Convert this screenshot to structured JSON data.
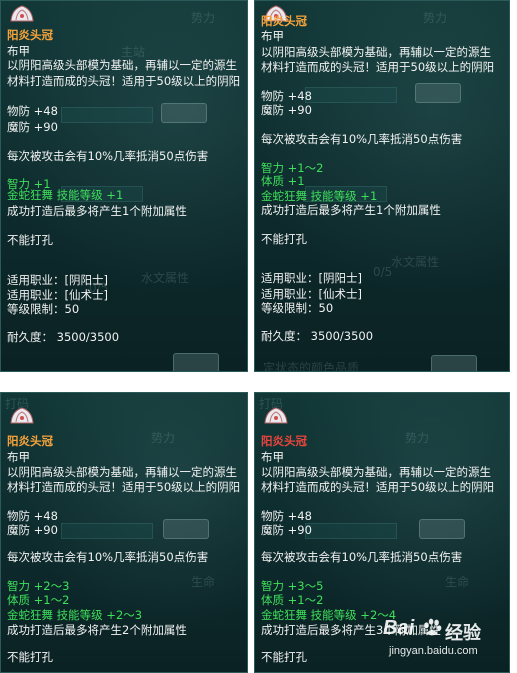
{
  "panels": [
    {
      "name_color": "#f5a23a",
      "name": "阳炎头冠",
      "type": "布甲",
      "desc1": "以阴阳高级头部模为基础，再辅以一定的源生",
      "desc2": "材料打造而成的头冠！适用于50级以上的阴阳",
      "phys_def": "物防 +48",
      "mag_def": "魔防 +90",
      "effect": "每次被攻击会有10%几率抵消50点伤害",
      "wisdom": "智力 +1",
      "stamina": "",
      "skill": "金蛇狂舞 技能等级 +1",
      "extra_attr": "成功打造后最多将产生1个附加属性",
      "socket": "不能打孔",
      "job1": "适用职业：[阴阳士]",
      "job2": "适用职业：[仙术士]",
      "level": "等级限制：50",
      "durability": "耐久度：  3500/3500"
    },
    {
      "name_color": "#f5a23a",
      "name": "阳炎头冠",
      "type": "布甲",
      "desc1": "以阴阳高级头部模为基础，再辅以一定的源生",
      "desc2": "材料打造而成的头冠！适用于50级以上的阴阳",
      "phys_def": "物防 +48",
      "mag_def": "魔防 +90",
      "effect": "每次被攻击会有10%几率抵消50点伤害",
      "wisdom": "智力 +1～2",
      "stamina": "体质 +1",
      "skill": "金蛇狂舞 技能等级 +1",
      "extra_attr": "成功打造后最多将产生1个附加属性",
      "socket": "不能打孔",
      "job1": "适用职业：[阴阳士]",
      "job2": "适用职业：[仙术士]",
      "level": "等级限制：50",
      "durability": "耐久度：  3500/3500"
    },
    {
      "name_color": "#f5a23a",
      "name": "阳炎头冠",
      "type": "布甲",
      "desc1": "以阴阳高级头部模为基础，再辅以一定的源生",
      "desc2": "材料打造而成的头冠！适用于50级以上的阴阳",
      "phys_def": "物防 +48",
      "mag_def": "魔防 +90",
      "effect": "每次被攻击会有10%几率抵消50点伤害",
      "wisdom": "智力 +2～3",
      "stamina": "体质 +1～2",
      "skill": "金蛇狂舞 技能等级 +2～3",
      "extra_attr": "成功打造后最多将产生2个附加属性",
      "socket": "不能打孔"
    },
    {
      "name_color": "#e8453c",
      "name": "阳炎头冠",
      "type": "布甲",
      "desc1": "以阴阳高级头部模为基础，再辅以一定的源生",
      "desc2": "材料打造而成的头冠！适用于50级以上的阴阳",
      "phys_def": "物防 +48",
      "mag_def": "魔防 +90",
      "effect": "每次被攻击会有10%几率抵消50点伤害",
      "wisdom": "智力 +3～5",
      "stamina": "体质 +1～2",
      "skill": "金蛇狂舞 技能等级 +2～4",
      "extra_attr": "成功打造后最多将产生3个附加属性",
      "socket": "不能打孔"
    }
  ],
  "watermark": {
    "brand": "Bai",
    "brand_cn": "经验",
    "url": "jingyan.baidu.com"
  }
}
